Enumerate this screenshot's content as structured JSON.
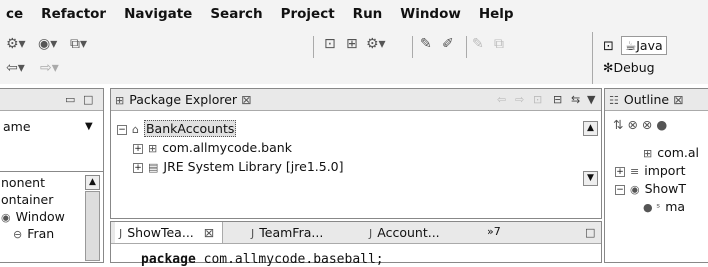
{
  "menu": [
    "ce",
    "Refactor",
    "Navigate",
    "Search",
    "Project",
    "Run",
    "Window",
    "Help"
  ],
  "perspectives": {
    "java": "Java",
    "debug": "Debug"
  },
  "left_panel": {
    "heading": "ame",
    "items": [
      "nonent",
      "ontainer",
      "Window",
      "Fran"
    ]
  },
  "package_explorer": {
    "title": "Package Explorer",
    "tree": [
      {
        "label": "BankAccounts",
        "level": 0
      },
      {
        "label": "com.allmycode.bank",
        "level": 1
      },
      {
        "label": "JRE System Library [jre1.5.0]",
        "level": 1
      }
    ]
  },
  "editor": {
    "tabs": [
      "ShowTea...",
      "TeamFra...",
      "Account..."
    ],
    "more": "»7",
    "keyword": "package",
    "rest": " com.allmycode.baseball;"
  },
  "outline": {
    "title": "Outline",
    "items": [
      "com.al",
      "import",
      "ShowT",
      "ma"
    ]
  },
  "colors": {
    "bg": "#f3f3f3",
    "border": "#888888",
    "selection": "#e0e0e0"
  }
}
